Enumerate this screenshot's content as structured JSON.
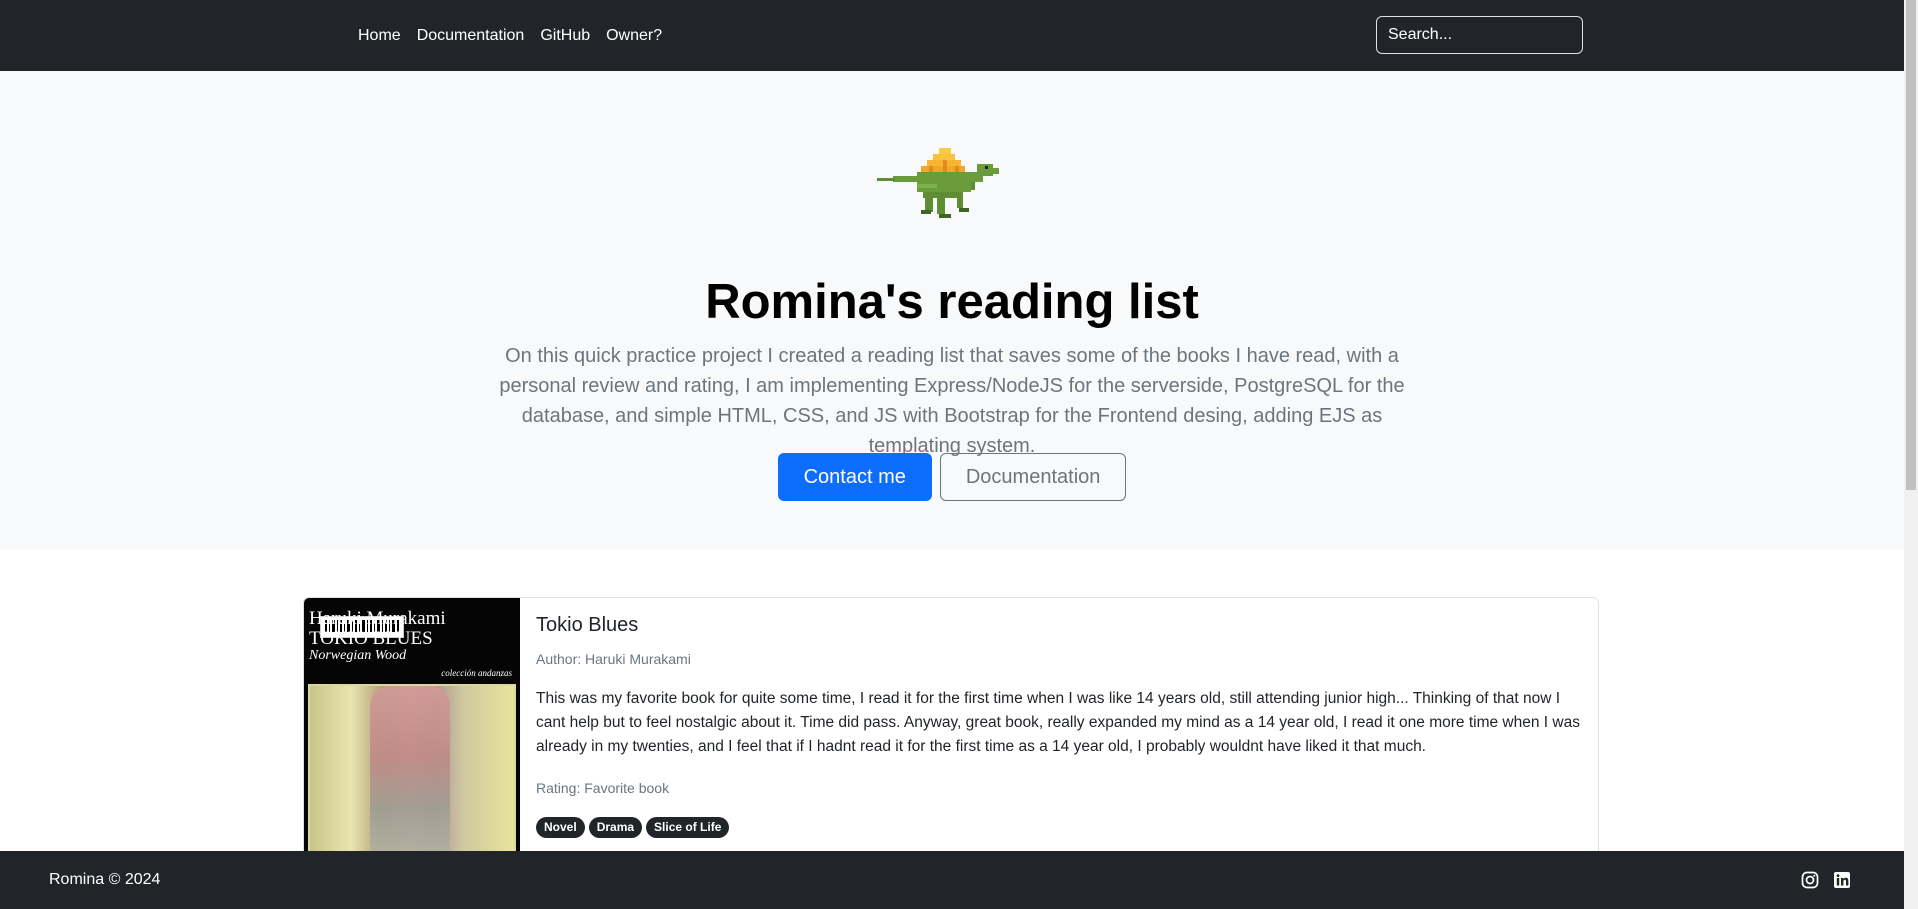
{
  "nav": {
    "links": [
      "Home",
      "Documentation",
      "GitHub",
      "Owner?"
    ],
    "search_placeholder": "Search..."
  },
  "hero": {
    "title": "Romina's reading list",
    "lead": "On this quick practice project I created a reading list that saves some of the books I have read, with a personal review and rating, I am implementing Express/NodeJS for the serverside, PostgreSQL for the database, and simple HTML, CSS, and JS with Bootstrap for the Frontend desing, adding EJS as templating system.",
    "primary_button": "Contact me",
    "secondary_button": "Documentation"
  },
  "book": {
    "cover": {
      "author": "Haruki Murakami",
      "title": "TOKIO BLUES",
      "subtitle": "Norwegian Wood",
      "collection": "colección andanzas"
    },
    "title": "Tokio Blues",
    "author": "Author: Haruki Murakami",
    "review": "This was my favorite book for quite some time, I read it for the first time when I was like 14 years old, still attending junior high... Thinking of that now I cant help but to feel nostalgic about it. Time did pass. Anyway, great book, really expanded my mind as a 14 year old, I read it one more time when I was already in my twenties, and I feel that if I hadnt read it for the first time as a 14 year old, I probably wouldnt have liked it that much.",
    "rating": "Rating: Favorite book",
    "tags": [
      "Novel",
      "Drama",
      "Slice of Life"
    ]
  },
  "footer": {
    "text": "Romina © 2024",
    "icons": [
      "instagram-icon",
      "linkedin-icon"
    ]
  },
  "colors": {
    "navbar": "#212529",
    "hero_bg": "#f8f9fa",
    "primary": "#0d6efd",
    "muted": "#6c757d"
  }
}
